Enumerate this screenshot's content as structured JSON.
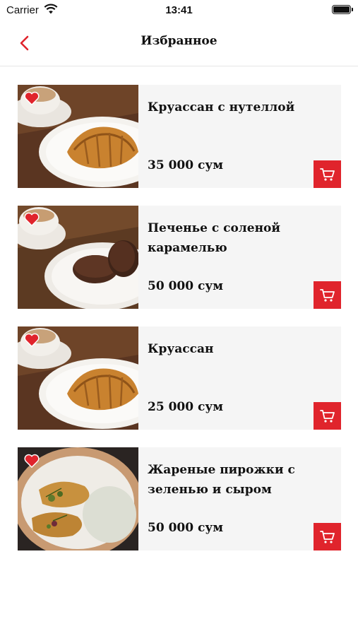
{
  "status_bar": {
    "carrier": "Carrier",
    "time": "13:41"
  },
  "nav": {
    "title": "Избранное",
    "back_icon": "chevron-left-icon"
  },
  "colors": {
    "accent": "#e0242c",
    "card_background": "#f5f5f5"
  },
  "products": [
    {
      "name": "Круассан с нутеллой",
      "price": "35 000 сум",
      "image": "croissant-with-coffee",
      "favorite": true
    },
    {
      "name": "Печенье с соленой карамелью",
      "price": "50 000 сум",
      "image": "chocolate-cookies-with-coffee",
      "favorite": true
    },
    {
      "name": "Круассан",
      "price": "25 000 сум",
      "image": "croissant-with-coffee",
      "favorite": true
    },
    {
      "name": "Жареные пирожки с зеленью и сыром",
      "price": "50 000 сум",
      "image": "fried-pies-with-sauce",
      "favorite": true
    }
  ]
}
